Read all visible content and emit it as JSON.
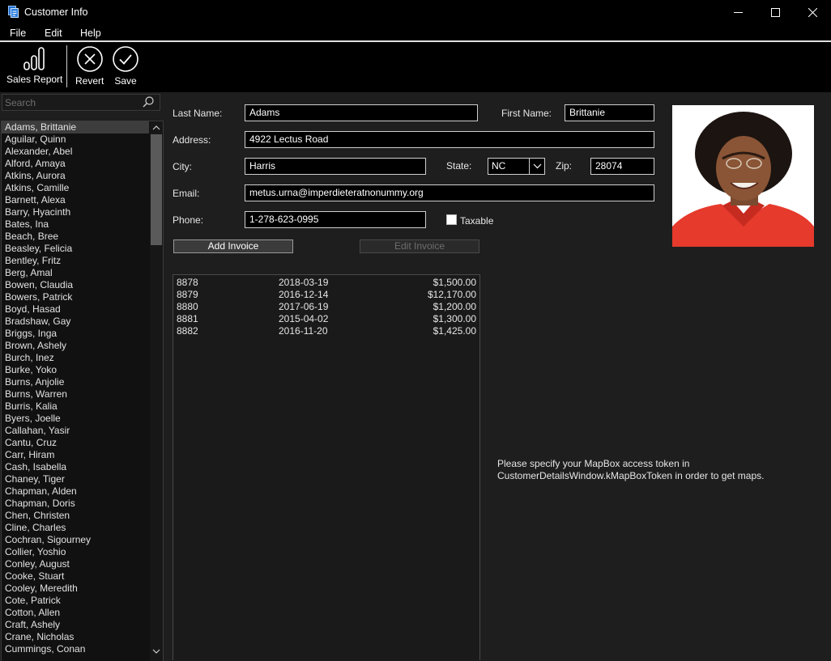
{
  "window": {
    "title": "Customer Info"
  },
  "menu": [
    "File",
    "Edit",
    "Help"
  ],
  "toolbar": {
    "sales_report": "Sales Report",
    "revert": "Revert",
    "save": "Save"
  },
  "search": {
    "placeholder": "Search",
    "value": ""
  },
  "customers": [
    "Adams, Brittanie",
    "Aguilar, Quinn",
    "Alexander, Abel",
    "Alford, Amaya",
    "Atkins, Aurora",
    "Atkins, Camille",
    "Barnett, Alexa",
    "Barry, Hyacinth",
    "Bates, Ina",
    "Beach, Bree",
    "Beasley, Felicia",
    "Bentley, Fritz",
    "Berg, Amal",
    "Bowen, Claudia",
    "Bowers, Patrick",
    "Boyd, Hasad",
    "Bradshaw, Gay",
    "Briggs, Inga",
    "Brown, Ashely",
    "Burch, Inez",
    "Burke, Yoko",
    "Burns, Anjolie",
    "Burns, Warren",
    "Burris, Kalia",
    "Byers, Joelle",
    "Callahan, Yasir",
    "Cantu, Cruz",
    "Carr, Hiram",
    "Cash, Isabella",
    "Chaney, Tiger",
    "Chapman, Alden",
    "Chapman, Doris",
    "Chen, Christen",
    "Cline, Charles",
    "Cochran, Sigourney",
    "Collier, Yoshio",
    "Conley, August",
    "Cooke, Stuart",
    "Cooley, Meredith",
    "Cote, Patrick",
    "Cotton, Allen",
    "Craft, Ashely",
    "Crane, Nicholas",
    "Cummings, Conan"
  ],
  "selected_index": 0,
  "form": {
    "last_name_label": "Last Name:",
    "last_name": "Adams",
    "first_name_label": "First Name:",
    "first_name": "Brittanie",
    "address_label": "Address:",
    "address": "4922 Lectus Road",
    "city_label": "City:",
    "city": "Harris",
    "state_label": "State:",
    "state": "NC",
    "zip_label": "Zip:",
    "zip": "28074",
    "email_label": "Email:",
    "email": "metus.urna@imperdieteratnonummy.org",
    "phone_label": "Phone:",
    "phone": "1-278-623-0995",
    "taxable_label": "Taxable",
    "taxable": false
  },
  "buttons": {
    "add_invoice": "Add Invoice",
    "edit_invoice": "Edit Invoice"
  },
  "invoices": [
    {
      "number": "8878",
      "date": "2018-03-19",
      "amount": "$1,500.00"
    },
    {
      "number": "8879",
      "date": "2016-12-14",
      "amount": "$12,170.00"
    },
    {
      "number": "8880",
      "date": "2017-06-19",
      "amount": "$1,200.00"
    },
    {
      "number": "8881",
      "date": "2015-04-02",
      "amount": "$1,300.00"
    },
    {
      "number": "8882",
      "date": "2016-11-20",
      "amount": "$1,425.00"
    }
  ],
  "map_message": {
    "line1": "Please specify your MapBox access token in",
    "line2": "CustomerDetailsWindow.kMapBoxToken in order to get maps."
  },
  "colors": {
    "background": "#1e1e1e",
    "chrome": "#000000",
    "selection": "#3d3d3d"
  }
}
